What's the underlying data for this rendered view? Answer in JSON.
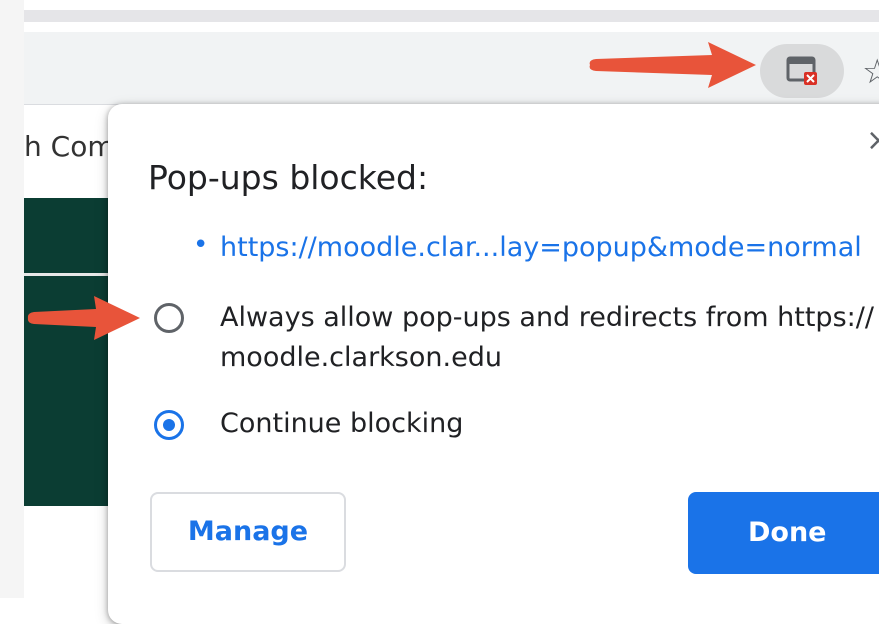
{
  "page": {
    "tab_text": "h Com"
  },
  "toolbar": {
    "popup_blocked_icon": "popup-blocked-icon",
    "star_icon": "☆"
  },
  "bubble": {
    "title": "Pop-ups blocked:",
    "close_icon": "×",
    "bullet": "•",
    "popup_link": "https://moodle.clar...lay=popup&mode=normal",
    "option_allow_line1": "Always allow pop-ups and redirects from https://",
    "option_allow_line2": "moodle.clarkson.edu",
    "option_block": "Continue blocking",
    "selected_option": "Continue blocking",
    "manage_label": "Manage",
    "done_label": "Done"
  },
  "colors": {
    "accent": "#1a73e8",
    "arrow": "#e8543a",
    "page_green": "#0b3d33"
  }
}
